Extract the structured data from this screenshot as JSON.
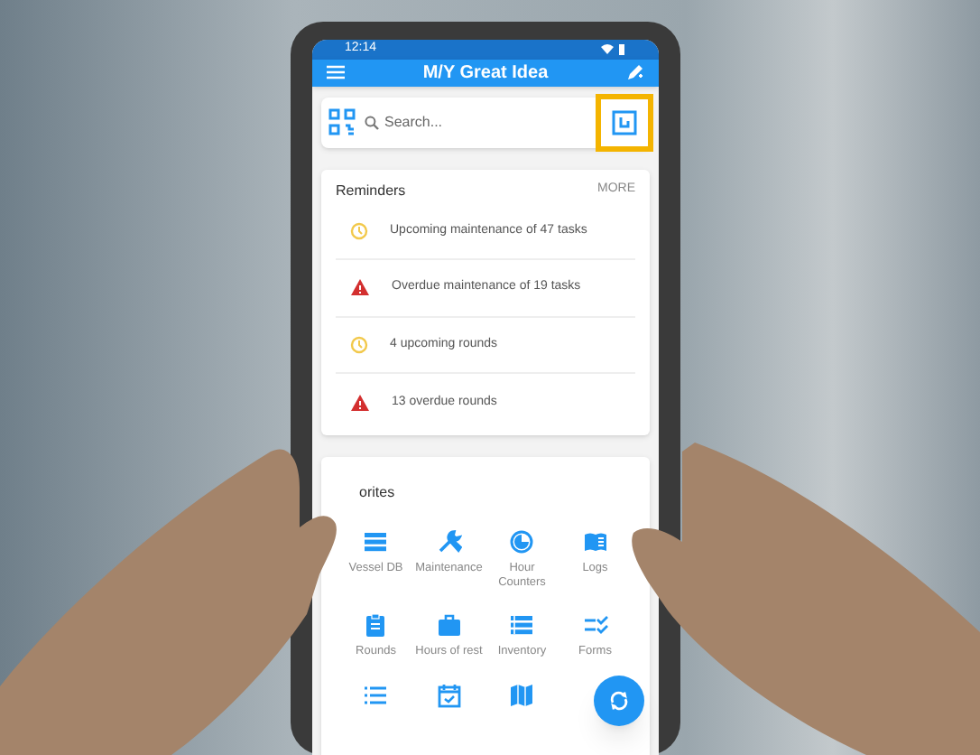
{
  "status_bar": {
    "time": "12:14"
  },
  "app_bar": {
    "title": "M/Y Great Idea"
  },
  "search": {
    "placeholder": "Search...",
    "nfc_highlighted": true
  },
  "reminders": {
    "title": "Reminders",
    "action": "MORE",
    "items": [
      {
        "kind": "upcoming",
        "text": "Upcoming maintenance of 47 tasks"
      },
      {
        "kind": "overdue",
        "text": "Overdue maintenance of 19 tasks"
      },
      {
        "kind": "upcoming",
        "text": "4 upcoming rounds"
      },
      {
        "kind": "overdue",
        "text": "13 overdue rounds"
      }
    ]
  },
  "favorites": {
    "title": "orites",
    "items": [
      {
        "kind": "database",
        "label": "Vessel DB"
      },
      {
        "kind": "wrench",
        "label": "Maintenance"
      },
      {
        "kind": "gauge",
        "label": "Hour\nCounters"
      },
      {
        "kind": "book",
        "label": "Logs"
      },
      {
        "kind": "clipboard",
        "label": "Rounds"
      },
      {
        "kind": "briefcase",
        "label": "Hours of rest"
      },
      {
        "kind": "list",
        "label": "Inventory"
      },
      {
        "kind": "checklist",
        "label": "Forms"
      },
      {
        "kind": "bullets"
      },
      {
        "kind": "calendar"
      },
      {
        "kind": "map"
      }
    ]
  }
}
